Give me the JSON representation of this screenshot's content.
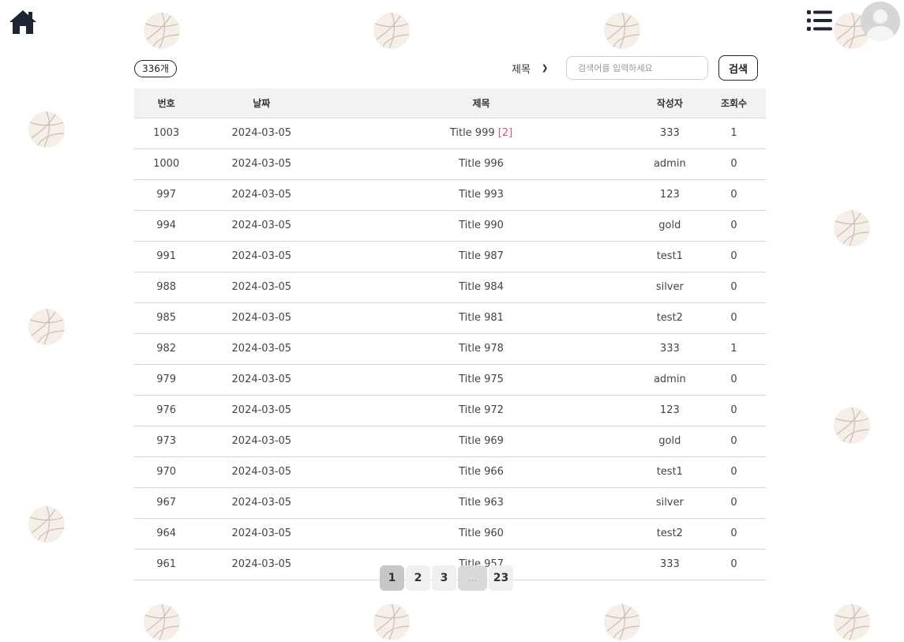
{
  "header": {
    "home_icon": "home-icon",
    "menu_icon": "list-menu-icon",
    "avatar_icon": "user-avatar-icon"
  },
  "board": {
    "count_label": "336개",
    "search": {
      "type_selected": "제목",
      "placeholder": "검색어를 입력하세요",
      "button_label": "검색"
    },
    "columns": [
      "번호",
      "날짜",
      "제목",
      "작성자",
      "조회수"
    ],
    "rows": [
      {
        "no": "1003",
        "date": "2024-03-05",
        "title": "Title 999",
        "comments": "[2]",
        "writer": "333",
        "views": "1"
      },
      {
        "no": "1000",
        "date": "2024-03-05",
        "title": "Title 996",
        "comments": "",
        "writer": "admin",
        "views": "0"
      },
      {
        "no": "997",
        "date": "2024-03-05",
        "title": "Title 993",
        "comments": "",
        "writer": "123",
        "views": "0"
      },
      {
        "no": "994",
        "date": "2024-03-05",
        "title": "Title 990",
        "comments": "",
        "writer": "gold",
        "views": "0"
      },
      {
        "no": "991",
        "date": "2024-03-05",
        "title": "Title 987",
        "comments": "",
        "writer": "test1",
        "views": "0"
      },
      {
        "no": "988",
        "date": "2024-03-05",
        "title": "Title 984",
        "comments": "",
        "writer": "silver",
        "views": "0"
      },
      {
        "no": "985",
        "date": "2024-03-05",
        "title": "Title 981",
        "comments": "",
        "writer": "test2",
        "views": "0"
      },
      {
        "no": "982",
        "date": "2024-03-05",
        "title": "Title 978",
        "comments": "",
        "writer": "333",
        "views": "1"
      },
      {
        "no": "979",
        "date": "2024-03-05",
        "title": "Title 975",
        "comments": "",
        "writer": "admin",
        "views": "0"
      },
      {
        "no": "976",
        "date": "2024-03-05",
        "title": "Title 972",
        "comments": "",
        "writer": "123",
        "views": "0"
      },
      {
        "no": "973",
        "date": "2024-03-05",
        "title": "Title 969",
        "comments": "",
        "writer": "gold",
        "views": "0"
      },
      {
        "no": "970",
        "date": "2024-03-05",
        "title": "Title 966",
        "comments": "",
        "writer": "test1",
        "views": "0"
      },
      {
        "no": "967",
        "date": "2024-03-05",
        "title": "Title 963",
        "comments": "",
        "writer": "silver",
        "views": "0"
      },
      {
        "no": "964",
        "date": "2024-03-05",
        "title": "Title 960",
        "comments": "",
        "writer": "test2",
        "views": "0"
      },
      {
        "no": "961",
        "date": "2024-03-05",
        "title": "Title 957",
        "comments": "",
        "writer": "333",
        "views": "0"
      }
    ]
  },
  "pagination": {
    "pages": [
      "1",
      "2",
      "3",
      "...",
      "23"
    ],
    "current": "1"
  },
  "colors": {
    "comment_accent": "#d2527a",
    "header_row_bg": "#f2f2f2",
    "ball_fill": "#f5ede4"
  },
  "decoration": {
    "background_icon": "volleyball-icon"
  }
}
